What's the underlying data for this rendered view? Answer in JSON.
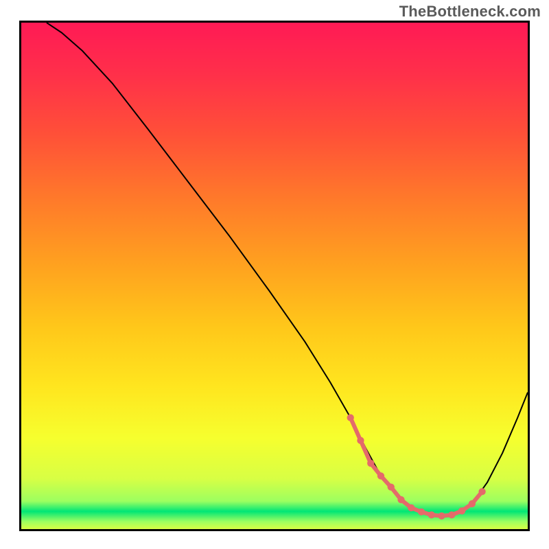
{
  "watermark": "TheBottleneck.com",
  "colors": {
    "gradient_stops": [
      {
        "offset": 0.0,
        "color": "#ff1a55"
      },
      {
        "offset": 0.1,
        "color": "#ff2f4a"
      },
      {
        "offset": 0.22,
        "color": "#ff5038"
      },
      {
        "offset": 0.35,
        "color": "#ff7a2a"
      },
      {
        "offset": 0.48,
        "color": "#ffa21f"
      },
      {
        "offset": 0.6,
        "color": "#ffc71a"
      },
      {
        "offset": 0.72,
        "color": "#ffe61f"
      },
      {
        "offset": 0.82,
        "color": "#f6ff2e"
      },
      {
        "offset": 0.9,
        "color": "#d8ff44"
      },
      {
        "offset": 0.945,
        "color": "#9cff60"
      },
      {
        "offset": 0.965,
        "color": "#00e676"
      },
      {
        "offset": 0.985,
        "color": "#9cff60"
      },
      {
        "offset": 1.0,
        "color": "#d8ff44"
      }
    ],
    "bottleneck_marker": "#e46a6a",
    "curve": "#000000"
  },
  "chart_data": {
    "type": "line",
    "title": "",
    "xlabel": "",
    "ylabel": "",
    "xlim": [
      0,
      100
    ],
    "ylim": [
      0,
      100
    ],
    "grid": false,
    "series": [
      {
        "name": "bottleneck-curve",
        "x": [
          5,
          8,
          12,
          18,
          25,
          33,
          41,
          49,
          56,
          61,
          65,
          68,
          71,
          74,
          77,
          80,
          83,
          86,
          89,
          92,
          95,
          98,
          100
        ],
        "values": [
          100,
          98,
          94.5,
          88,
          79,
          68.5,
          58,
          47,
          37,
          29,
          22,
          16,
          10.5,
          6.8,
          4.2,
          3.0,
          2.6,
          3.1,
          5.0,
          9.2,
          15,
          22,
          27
        ]
      }
    ],
    "bottleneck_marker": {
      "x": [
        65,
        67,
        69,
        71,
        73,
        75,
        77,
        79,
        81,
        83,
        85,
        87,
        89,
        91
      ],
      "values": [
        22,
        17.5,
        13,
        10.5,
        8.3,
        5.8,
        4.2,
        3.4,
        2.8,
        2.6,
        2.8,
        3.6,
        5.0,
        7.4
      ],
      "dot_radius": 4.5
    }
  }
}
